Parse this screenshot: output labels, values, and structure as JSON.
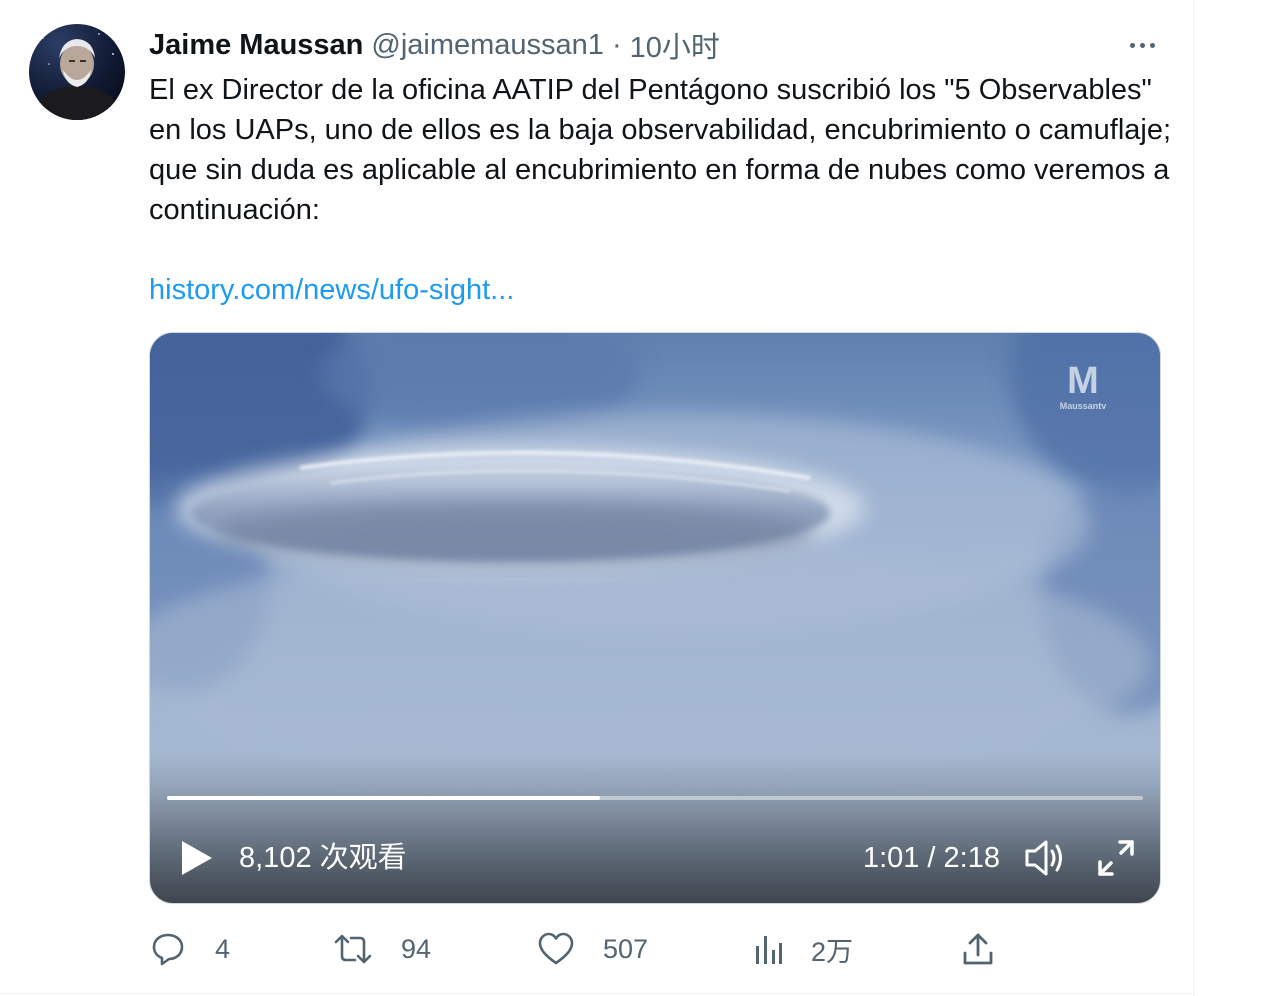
{
  "author": {
    "name": "Jaime Maussan",
    "handle": "@jaimemaussan1",
    "separator": "·",
    "time": "10小时"
  },
  "tweet": {
    "text": "El ex Director de la oficina AATIP del Pentágono suscribió los \"5 Observables\" en los UAPs, uno de ellos es la baja observabilidad, encubrimiento o camuflaje; que sin duda es aplicable al encubrimiento en forma de nubes como veremos a continuación:",
    "link": "history.com/news/ufo-sight..."
  },
  "video": {
    "views": "8,102 次观看",
    "timecode": "1:01 / 2:18",
    "progress": 0.444,
    "watermark_letter": "M",
    "watermark_text": "Maussantv"
  },
  "actions": {
    "replies": "4",
    "retweets": "94",
    "likes": "507",
    "views": "2万"
  },
  "colors": {
    "link": "#1d9bf0",
    "secondary_text": "#536471",
    "primary_text": "#0f1419"
  },
  "icons": [
    "avatar-photo",
    "more-icon",
    "play-icon",
    "volume-icon",
    "fullscreen-icon",
    "reply-icon",
    "retweet-icon",
    "like-icon",
    "analytics-icon",
    "share-icon"
  ]
}
